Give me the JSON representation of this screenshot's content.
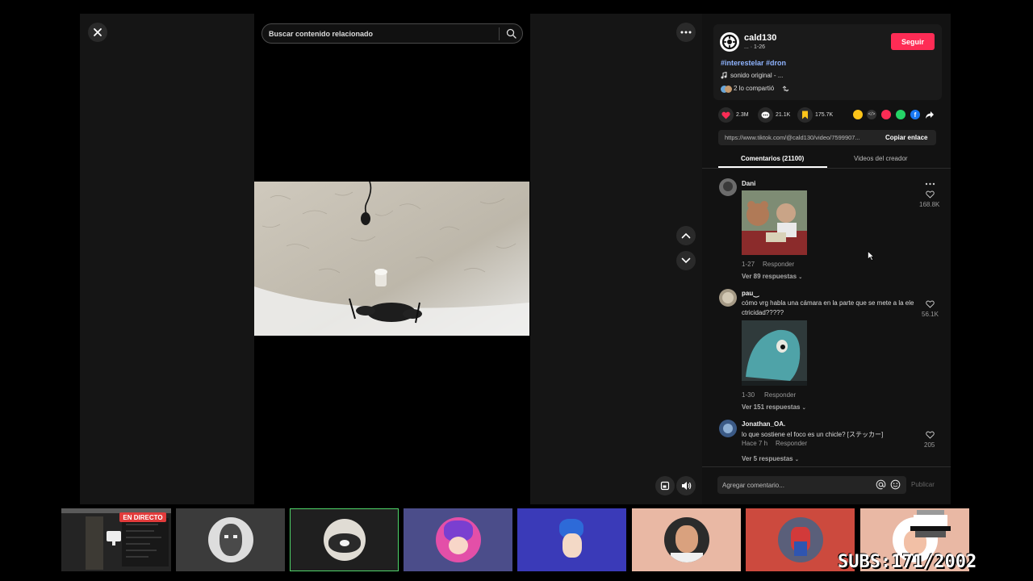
{
  "search": {
    "placeholder": "Buscar contenido relacionado"
  },
  "author": {
    "name": "cald130",
    "meta": "... · 1-26",
    "follow_label": "Seguir",
    "hashtags": "#interestelar #dron",
    "sound": "sonido original - ...",
    "shared": "2 lo compartió"
  },
  "stats": {
    "likes": "2.3M",
    "comments": "21.1K",
    "saves": "175.7K"
  },
  "link": {
    "url": "https://www.tiktok.com/@cald130/video/7599907...",
    "copy_label": "Copiar enlace"
  },
  "tabs": [
    {
      "label": "Comentarios (21100)",
      "active": true
    },
    {
      "label": "Videos del creador",
      "active": false
    }
  ],
  "comments": [
    {
      "user": "Dani",
      "text": "",
      "date": "1-27",
      "reply_label": "Responder",
      "likes": "168.8K",
      "replies": "Ver 89 respuestas"
    },
    {
      "user": "pau⏝",
      "text_line1": "cómo vrg habla una cámara en la parte que se mete a la ele",
      "text_line2": "ctricidad?????",
      "date": "1-30",
      "reply_label": "Responder",
      "likes": "56.1K",
      "replies": "Ver 151 respuestas"
    },
    {
      "user": "Jonathan_OA.",
      "text": "lo que sostiene el foco es un chicle? [ステッカー]",
      "date": "Hace 7 h",
      "reply_label": "Responder",
      "likes": "205",
      "replies": "Ver 5 respuestas"
    }
  ],
  "compose": {
    "placeholder": "Agregar comentario...",
    "post_label": "Publicar"
  },
  "stream": {
    "live_label": "EN DIRECTO",
    "subs_text": "SUBS:171/2002"
  },
  "colors": {
    "accent": "#fe2c55",
    "hashtag": "#8fb4ff",
    "panel": "#121212"
  }
}
